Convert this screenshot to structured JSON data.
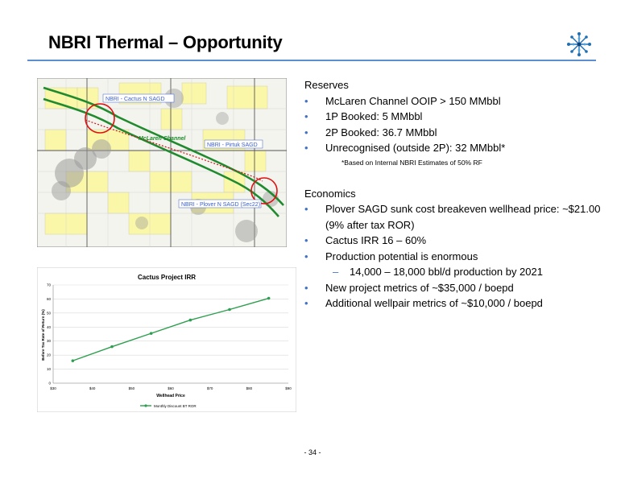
{
  "slide": {
    "title": "NBRI Thermal – Opportunity",
    "page_number": "- 34 -"
  },
  "map": {
    "labels": {
      "cactus": "NBRI - Cactus N SAGD",
      "channel": "McLaren Channel",
      "pirtuk": "NBRI - Pirtuk SAGD",
      "plover": "NBRI - Plover N SAGD (Sec22)"
    }
  },
  "reserves": {
    "heading": "Reserves",
    "items": [
      "McLaren Channel OOIP > 150 MMbbl",
      "1P Booked: 5 MMbbl",
      "2P Booked:  36.7 MMbbl",
      "Unrecognised (outside 2P):  32 MMbbl*"
    ],
    "note": "*Based on Internal NBRI Estimates of 50% RF"
  },
  "economics": {
    "heading": "Economics",
    "items": [
      "Plover SAGD sunk cost breakeven wellhead price: ~$21.00 (9% after tax ROR)",
      "Cactus IRR 16 – 60%",
      "Production potential is enormous"
    ],
    "subitem": "14,000 – 18,000 bbl/d production by 2021",
    "items2": [
      "New project metrics of ~$35,000 / boepd",
      "Additional wellpair metrics of ~$10,000 / boepd"
    ]
  },
  "chart_data": {
    "type": "line",
    "title": "Cactus Project IRR",
    "xlabel": "Wellhead Price",
    "ylabel": "Before Tax Rate of Return (%)",
    "x_ticks": [
      "$30",
      "$40",
      "$50",
      "$60",
      "$70",
      "$80",
      "$90"
    ],
    "y_ticks": [
      "0",
      "10",
      "20",
      "30",
      "40",
      "50",
      "60",
      "70"
    ],
    "xlim": [
      30,
      90
    ],
    "ylim": [
      0,
      70
    ],
    "grid": true,
    "legend_position": "bottom",
    "series": [
      {
        "name": "Monthly Discount BT ROR",
        "color": "#2e9e4f",
        "x": [
          35,
          45,
          55,
          65,
          75,
          85
        ],
        "y": [
          16,
          26,
          35.5,
          45,
          52.5,
          60.5
        ]
      }
    ]
  }
}
